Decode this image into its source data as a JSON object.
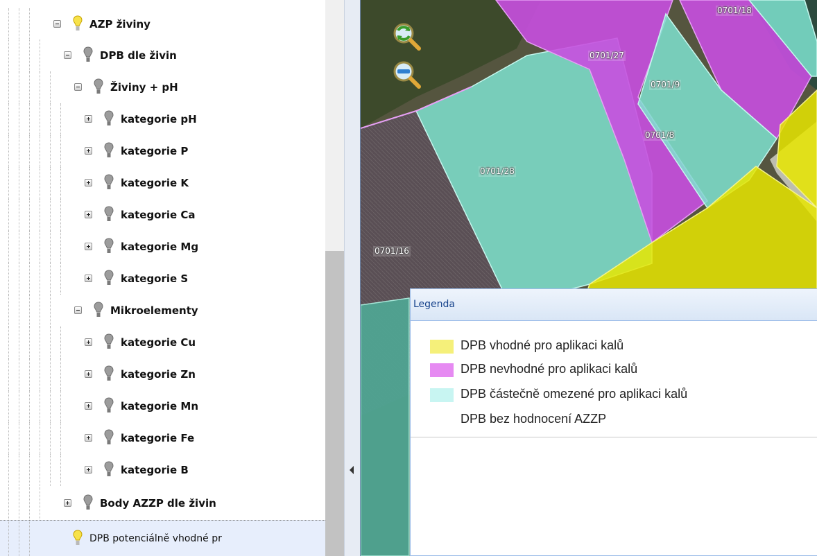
{
  "tree": {
    "items": [
      {
        "label": "AZP živiny",
        "expanded": true,
        "bulb": "yellow"
      },
      {
        "label": "DPB dle živin",
        "expanded": true,
        "bulb": "gray"
      },
      {
        "label": "Živiny + pH",
        "expanded": true,
        "bulb": "gray"
      },
      {
        "label": "kategorie pH",
        "expanded": false,
        "bulb": "gray"
      },
      {
        "label": "kategorie P",
        "expanded": false,
        "bulb": "gray"
      },
      {
        "label": "kategorie K",
        "expanded": false,
        "bulb": "gray"
      },
      {
        "label": "kategorie Ca",
        "expanded": false,
        "bulb": "gray"
      },
      {
        "label": "kategorie Mg",
        "expanded": false,
        "bulb": "gray"
      },
      {
        "label": "kategorie S",
        "expanded": false,
        "bulb": "gray"
      },
      {
        "label": "Mikroelementy",
        "expanded": true,
        "bulb": "gray"
      },
      {
        "label": "kategorie Cu",
        "expanded": false,
        "bulb": "gray"
      },
      {
        "label": "kategorie Zn",
        "expanded": false,
        "bulb": "gray"
      },
      {
        "label": "kategorie Mn",
        "expanded": false,
        "bulb": "gray"
      },
      {
        "label": "kategorie Fe",
        "expanded": false,
        "bulb": "gray"
      },
      {
        "label": "kategorie B",
        "expanded": false,
        "bulb": "gray"
      },
      {
        "label": "Body AZZP dle živin",
        "expanded": false,
        "bulb": "gray"
      },
      {
        "label": "DPB potenciálně vhodné pr",
        "selected": true,
        "bulb": "yellow"
      }
    ]
  },
  "map": {
    "parcel_labels": [
      "0701/18",
      "0701/27",
      "0701/9",
      "0701/8",
      "0701/28",
      "0701/16"
    ],
    "colors": {
      "suitable": "#e8e600",
      "unsuitable": "#c84fe0",
      "partial": "#7fe3d0",
      "imagery": "#5b5a4c"
    }
  },
  "legend": {
    "title": "Legenda",
    "items": [
      {
        "label": "DPB vhodné pro aplikaci kalů",
        "color": "#f5f07a"
      },
      {
        "label": "DPB nevhodné pro aplikaci kalů",
        "color": "#e68af2"
      },
      {
        "label": "DPB částečně omezené pro aplikaci kalů",
        "color": "#c8f5f2"
      },
      {
        "label": "DPB bez hodnocení AZZP",
        "color": "#ffffff"
      }
    ]
  },
  "icons": {
    "zoom_in": "zoom-in-icon",
    "zoom_out": "zoom-out-icon",
    "bulb_on": "lightbulb-on-icon",
    "bulb_off": "lightbulb-off-icon",
    "collapse": "collapse-left-arrow-icon"
  }
}
